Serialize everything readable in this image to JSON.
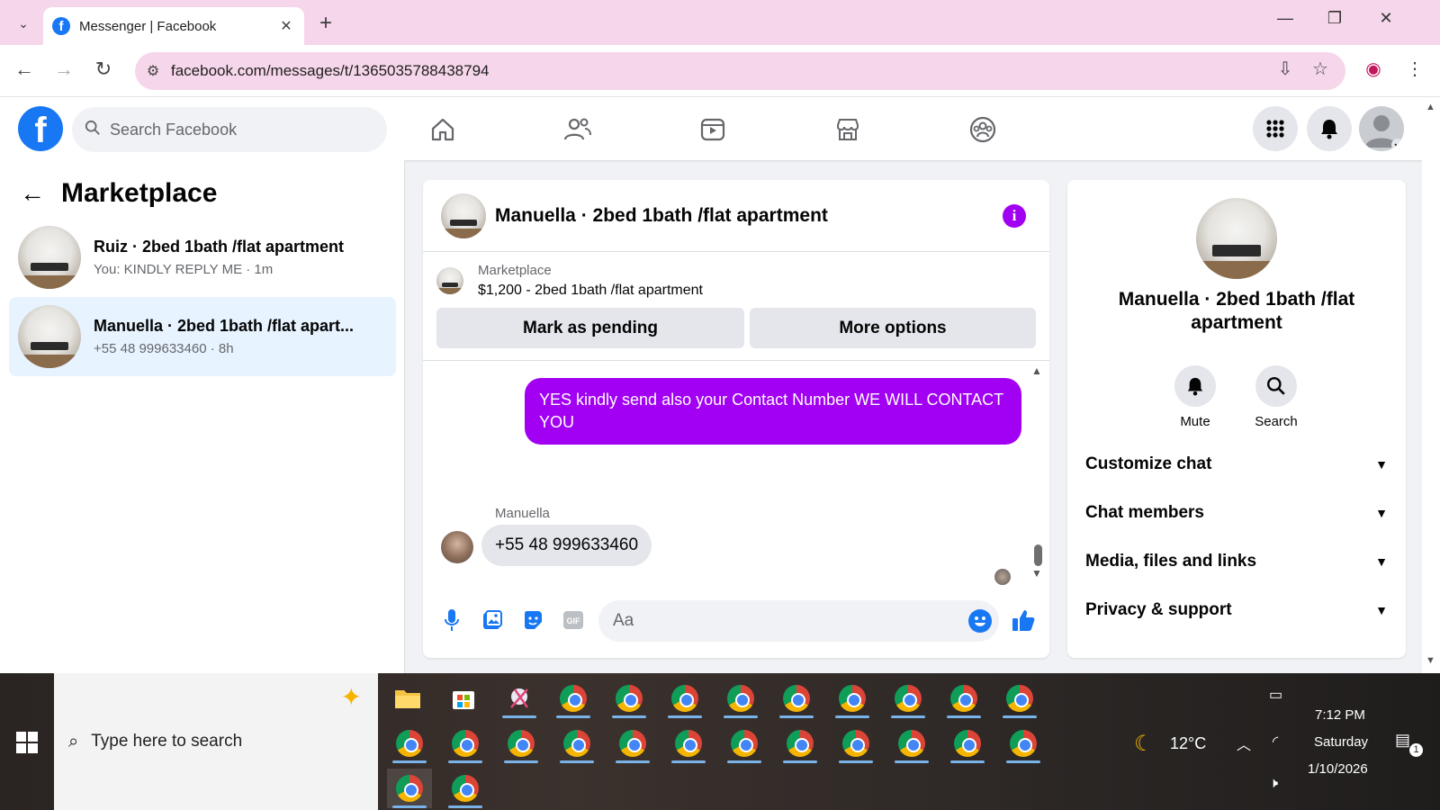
{
  "browser": {
    "tab_title": "Messenger | Facebook",
    "url": "facebook.com/messages/t/1365035788438794"
  },
  "fb": {
    "search_placeholder": "Search Facebook"
  },
  "left_panel": {
    "title": "Marketplace",
    "conversations": [
      {
        "name": "Ruiz · 2bed 1bath /flat apartment",
        "preview": "You: KINDLY REPLY ME · 1m",
        "active": false
      },
      {
        "name": "Manuella · 2bed 1bath /flat apart...",
        "preview": "+55 48 999633460 · 8h",
        "active": true
      }
    ]
  },
  "chat": {
    "title": "Manuella · 2bed 1bath /flat apartment",
    "marketplace_label": "Marketplace",
    "listing": "$1,200 - 2bed 1bath /flat apartment",
    "btn_pending": "Mark as pending",
    "btn_more": "More options",
    "outgoing_message": "YES kindly send also your Contact Number  WE WILL CONTACT YOU",
    "incoming_sender": "Manuella",
    "incoming_message": "+55 48 999633460",
    "input_placeholder": "Aa",
    "colors": {
      "accent": "#a100f2",
      "brand": "#1877f2"
    }
  },
  "right_panel": {
    "name": "Manuella · 2bed 1bath /flat apartment",
    "actions": [
      {
        "label": "Mute"
      },
      {
        "label": "Search"
      }
    ],
    "sections": [
      {
        "label": "Customize chat"
      },
      {
        "label": "Chat members"
      },
      {
        "label": "Media, files and links"
      },
      {
        "label": "Privacy & support"
      }
    ]
  },
  "taskbar": {
    "search_placeholder": "Type here to search",
    "temperature": "12°C",
    "time": "7:12 PM",
    "day": "Saturday",
    "date": "1/10/2026",
    "notification_count": "1"
  }
}
